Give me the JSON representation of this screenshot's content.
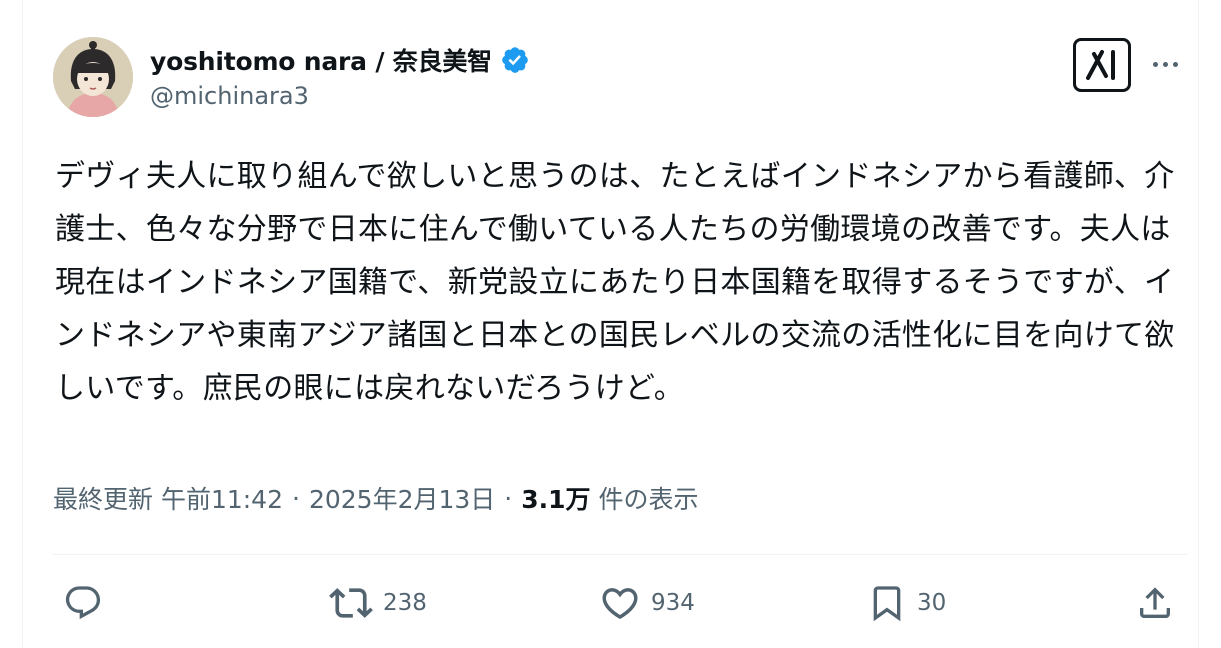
{
  "author": {
    "display_name": "yoshitomo nara / 奈良美智",
    "handle": "@michinara3",
    "verified": true
  },
  "tweet": {
    "text": "デヴィ夫人に取り組んで欲しいと思うのは、たとえばインドネシアから看護師、介護士、色々な分野で日本に住んで働いている人たちの労働環境の改善です。夫人は現在はインドネシア国籍で、新党設立にあたり日本国籍を取得するそうですが、インドネシアや東南アジア諸国と日本との国民レベルの交流の活性化に目を向けて欲しいです。庶民の眼には戻れないだろうけど。",
    "time": "最終更新 午前11:42",
    "separator": "·",
    "date": "2025年2月13日",
    "views_count": "3.1万",
    "views_label": "件の表示"
  },
  "actions": {
    "reply_count": "",
    "retweet_count": "238",
    "like_count": "934",
    "bookmark_count": "30"
  },
  "icons": {
    "verified": "verified-badge-icon",
    "grok": "grok-icon",
    "more": "more-dots-icon",
    "reply": "reply-bubble-icon",
    "retweet": "retweet-arrows-icon",
    "like": "heart-icon",
    "bookmark": "bookmark-icon",
    "share": "share-upload-icon"
  },
  "colors": {
    "text": "#0f1419",
    "secondary": "#536471",
    "verified_blue": "#1d9bf0",
    "divider": "#eff3f4"
  }
}
